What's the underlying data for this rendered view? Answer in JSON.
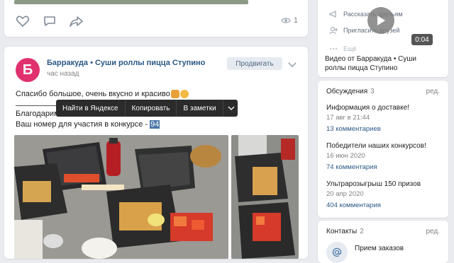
{
  "top_post": {
    "views": "1"
  },
  "post": {
    "avatar_letter": "Б",
    "author": "Барракуда • Суши роллы пицца Ступино",
    "time": "час назад",
    "promote_label": "Продвигать",
    "text_line1": "Спасибо большое, очень вкусно и красиво",
    "text_line2": "Благодарим",
    "text_line3_prefix": "Ваш номер для участия в конкурсе - ",
    "text_line3_selected": "94"
  },
  "context_menu": {
    "items": [
      "Найти в Яндексе",
      "Копировать",
      "В заметки"
    ]
  },
  "sidebar": {
    "video": {
      "menu_item_1": "Рассказать друзьям",
      "menu_item_2": "Пригласить друзей",
      "menu_item_3": "Ещё",
      "duration": "0:04",
      "title": "Видео от Барракуда • Суши роллы пицца Ступино"
    },
    "discussions": {
      "heading": "Обсуждения",
      "count": "3",
      "edit": "ред.",
      "items": [
        {
          "title": "Информация о доставке!",
          "date": "17 авг в 21:44",
          "comments": "13 комментариев"
        },
        {
          "title": "Победители наших конкурсов!",
          "date": "16 июн 2020",
          "comments": "74 комментария"
        },
        {
          "title": "Ультрарозыгрыш 150 призов",
          "date": "20 апр 2020",
          "comments": "404 комментария"
        }
      ]
    },
    "contacts": {
      "heading": "Контакты",
      "count": "2",
      "edit": "ред.",
      "first_name": "Прием заказов"
    }
  },
  "colors": {
    "accent": "#4a76a8",
    "link": "#2a5885",
    "avatar": "#e0316e"
  }
}
